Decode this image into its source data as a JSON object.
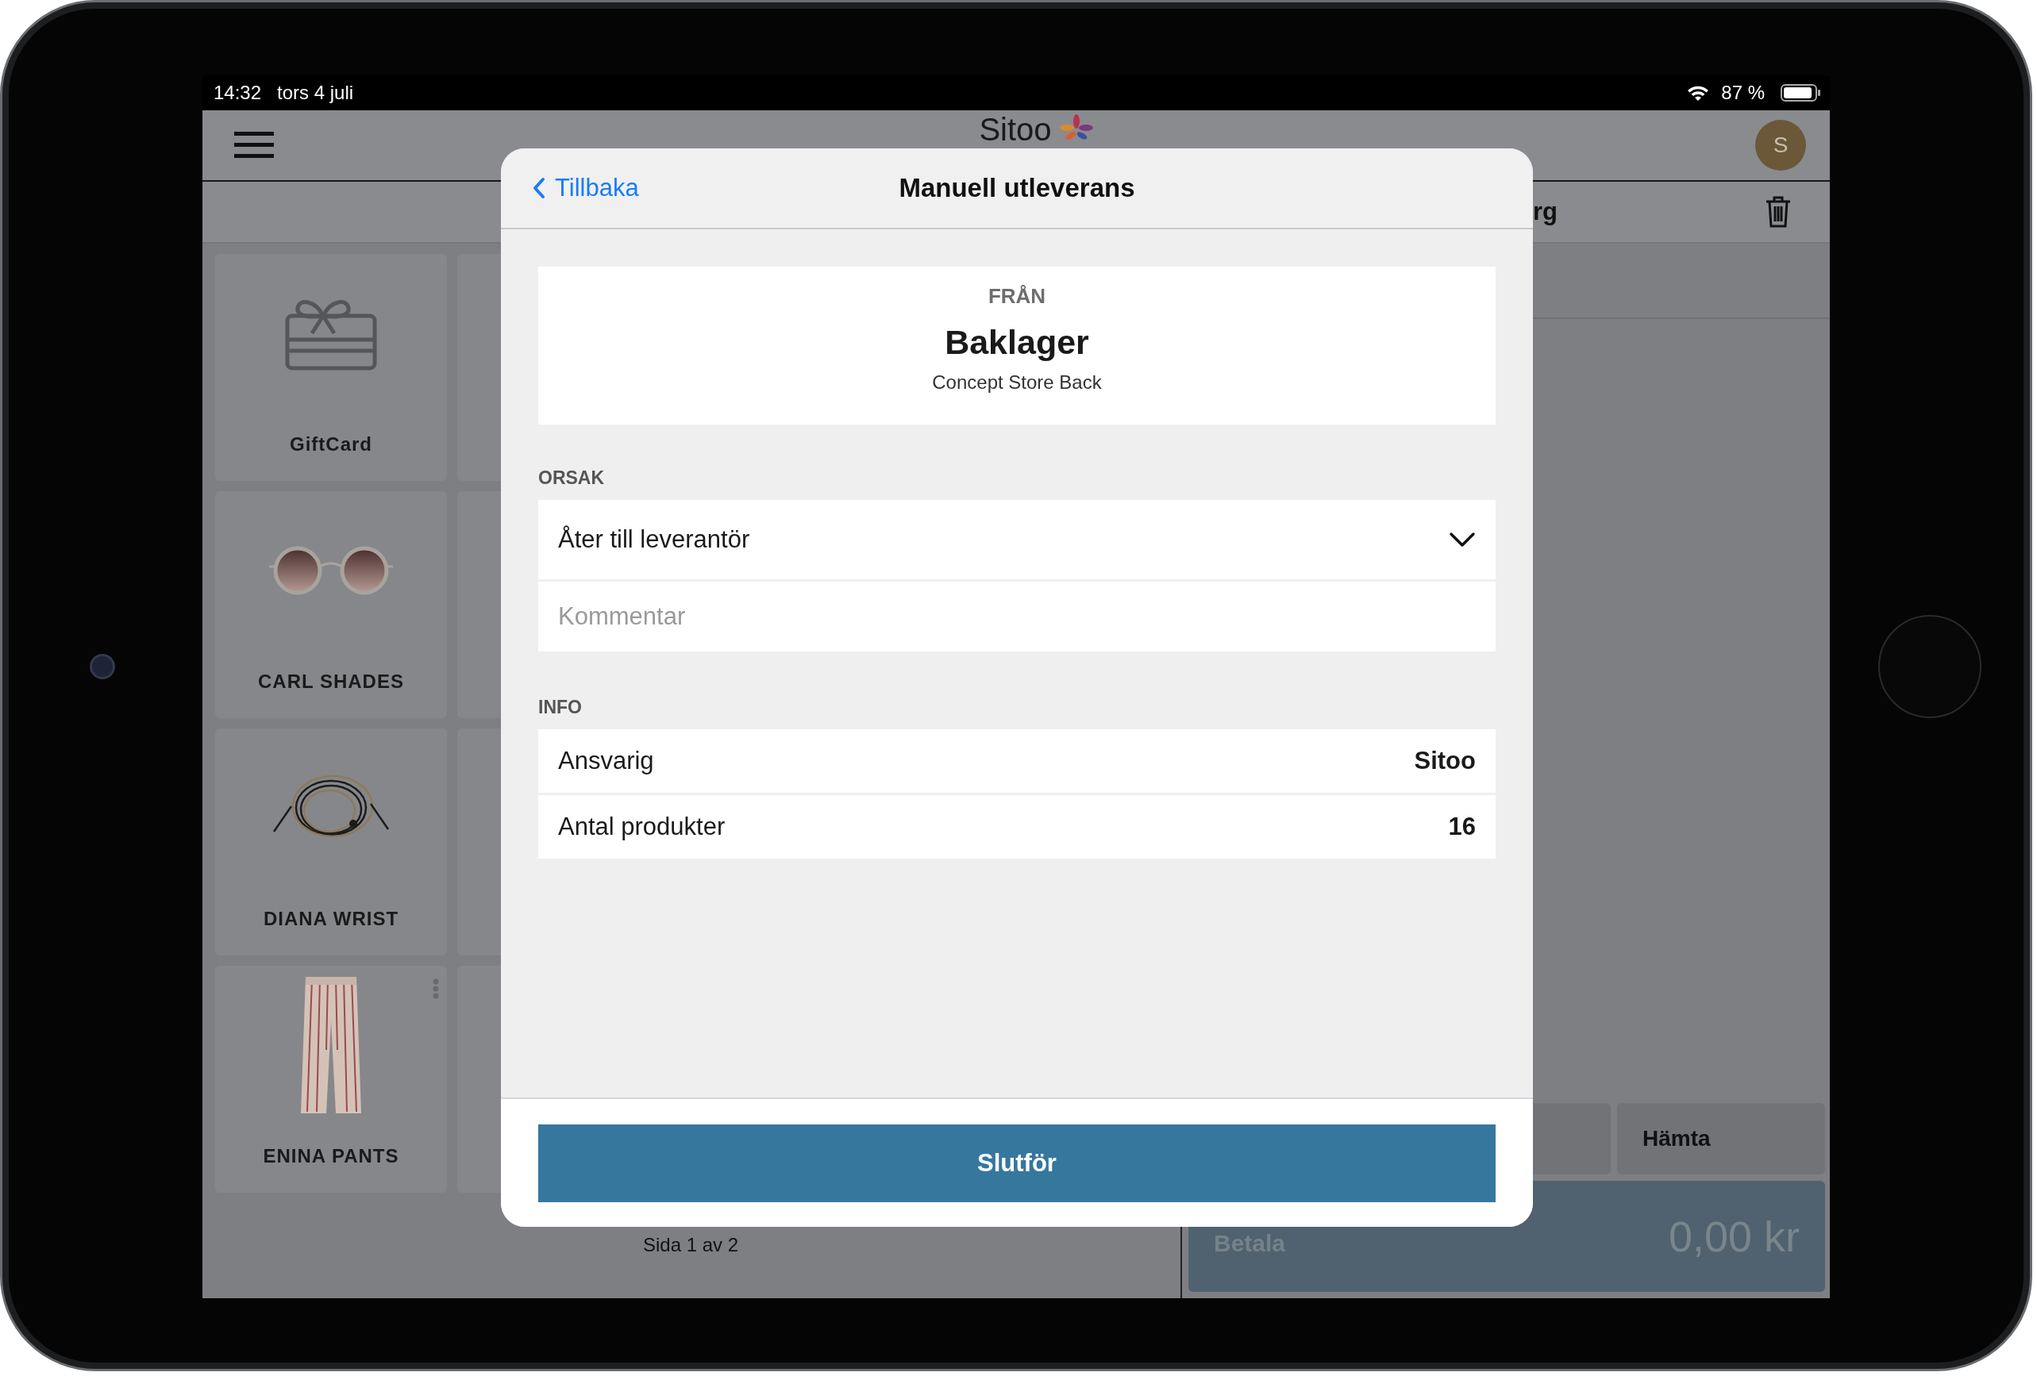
{
  "status_bar": {
    "time": "14:32",
    "date": "tors 4 juli",
    "battery": "87 %"
  },
  "header": {
    "logo": "Sitoo",
    "avatar": "S",
    "cart_title": "rg"
  },
  "products": [
    {
      "kind": "giftcard",
      "name": "GiftCard",
      "has_menu": false
    },
    {
      "kind": "sunglasses",
      "name": "CARL SHADES",
      "has_menu": false
    },
    {
      "kind": "bracelet",
      "name": "DIANA WRIST",
      "has_menu": false
    },
    {
      "kind": "pants",
      "name": "ENINA PANTS",
      "has_menu": true
    },
    {
      "kind": "blank"
    },
    {
      "kind": "blank"
    },
    {
      "kind": "blank"
    },
    {
      "kind": "blank"
    }
  ],
  "pager": "Sida 1 av 2",
  "action_buttons": [
    {
      "kind": "blank"
    },
    {
      "kind": "text",
      "label": "Hämta"
    }
  ],
  "pay": {
    "label": "Betala",
    "amount": "0,00 kr"
  },
  "modal": {
    "back": "Tillbaka",
    "title": "Manuell utleverans",
    "from": {
      "label": "FRÅN",
      "name": "Baklager",
      "sub": "Concept Store Back"
    },
    "reason": {
      "label": "ORSAK",
      "value": "Åter till leverantör"
    },
    "comment": {
      "placeholder": "Kommentar"
    },
    "info": {
      "label": "INFO",
      "rows": [
        {
          "label": "Ansvarig",
          "value": "Sitoo"
        },
        {
          "label": "Antal produkter",
          "value": "16"
        }
      ]
    },
    "submit": "Slutför"
  }
}
